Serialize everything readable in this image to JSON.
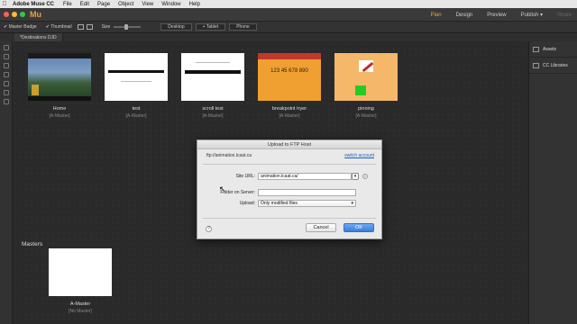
{
  "mac_menubar": {
    "app_name": "Adobe Muse CC",
    "items": [
      "File",
      "Edit",
      "Page",
      "Object",
      "View",
      "Window",
      "Help"
    ]
  },
  "appbar": {
    "logo": "Mu",
    "modes": [
      {
        "label": "Plan",
        "active": true
      },
      {
        "label": "Design",
        "active": false
      },
      {
        "label": "Preview",
        "active": false
      },
      {
        "label": "Publish ▾",
        "active": false
      },
      {
        "label": "Share",
        "active": false
      }
    ]
  },
  "toolbar": {
    "master_badge": "✔ Master Badge",
    "thumbnail": "✔ Thumbnail",
    "size_label": "Size",
    "buttons": [
      "Desktop",
      "+ Tablet",
      "Phone"
    ]
  },
  "tab": {
    "label": "*Destinations DJD"
  },
  "right_panel": {
    "items": [
      "Assets",
      "CC Libraries"
    ]
  },
  "pages": [
    {
      "name": "Home",
      "master": "[A-Master]"
    },
    {
      "name": "test",
      "master": "[A-Master]"
    },
    {
      "name": "scroll test",
      "master": "[A-Master]"
    },
    {
      "name": "breakpoint tryer",
      "master": "[A-Master]",
      "thumb_text": "123 45 678 890"
    },
    {
      "name": "pinning",
      "master": "[A-Master]"
    }
  ],
  "masters": {
    "heading": "Masters",
    "items": [
      {
        "name": "A-Master",
        "master": "[No Master]"
      }
    ]
  },
  "dialog": {
    "title": "Upload to FTP Host",
    "ftp_host": "ftp://animation.lcaat.ca",
    "switch_account": "switch account",
    "site_url_label": "Site URL:",
    "site_url_value": "animation.lcaat.ca/",
    "folder_label": "Folder on Server:",
    "folder_value": "",
    "upload_label": "Upload:",
    "upload_value": "Only modified files",
    "cancel": "Cancel",
    "ok": "OK",
    "help": "?"
  },
  "colors": {
    "accent": "#f0a040",
    "ok_button": "#3b7ddc",
    "link": "#1a5fc0"
  }
}
